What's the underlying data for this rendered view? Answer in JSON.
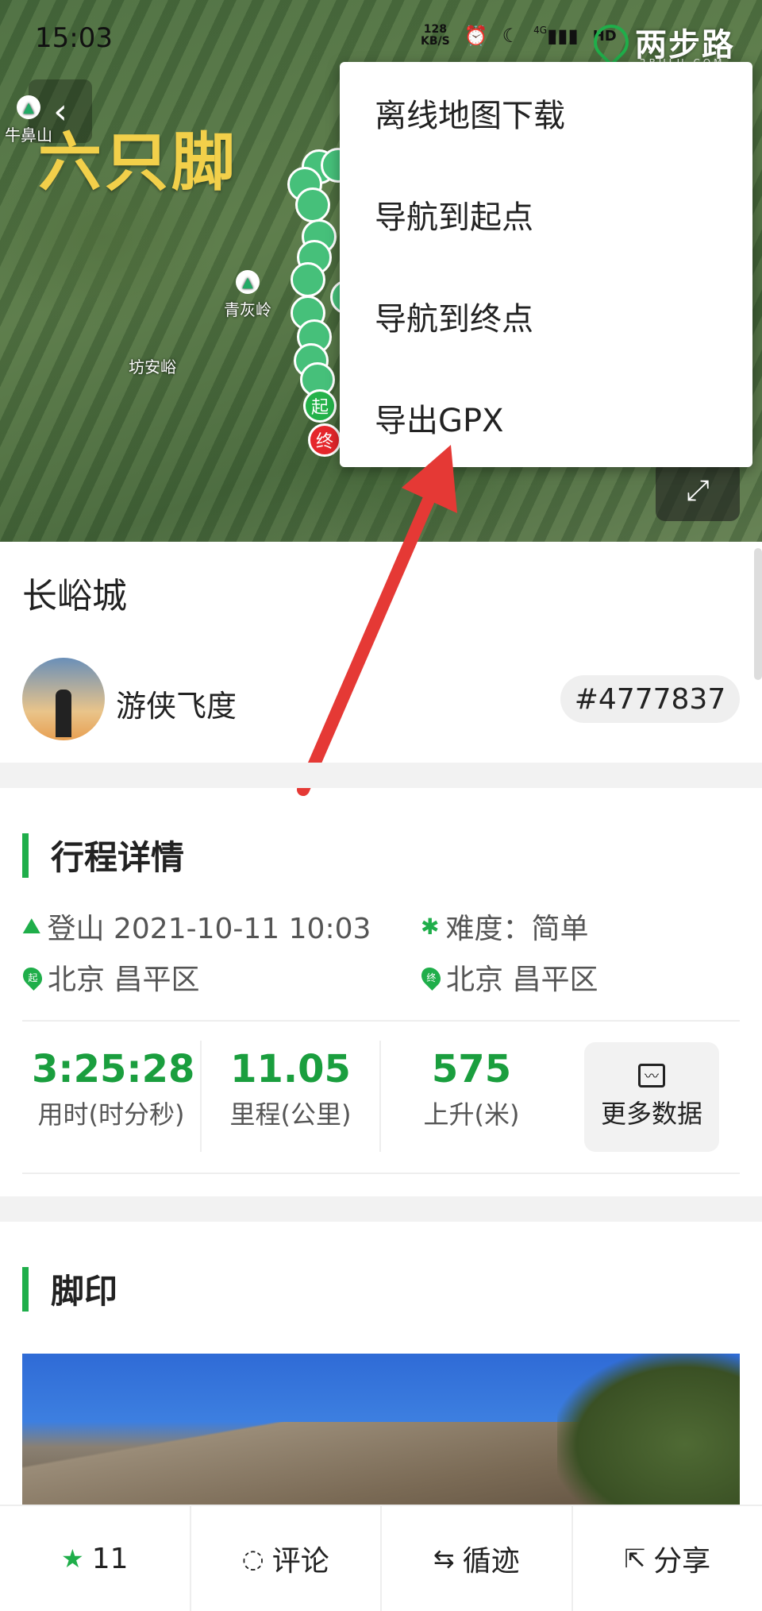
{
  "status": {
    "time": "15:03",
    "netspeed_top": "128",
    "netspeed_unit": "KB/S",
    "signal": "4G",
    "hd": "HD"
  },
  "brand": {
    "name": "两步路",
    "sub": "2BULU.COM"
  },
  "map": {
    "logo_text": "六只脚",
    "places": [
      {
        "name": "牛鼻山"
      },
      {
        "name": "青灰岭"
      },
      {
        "name": "坊安峪"
      }
    ],
    "start_label": "起",
    "end_label": "终"
  },
  "menu": {
    "items": [
      {
        "label": "离线地图下载"
      },
      {
        "label": "导航到起点"
      },
      {
        "label": "导航到终点"
      },
      {
        "label": "导出GPX"
      }
    ]
  },
  "trip": {
    "title": "长峪城",
    "user": "游侠飞度",
    "id": "#4777837"
  },
  "details": {
    "section_title": "行程详情",
    "activity": "登山 2021-10-11 10:03",
    "difficulty": "难度：简单",
    "start_place": "北京 昌平区",
    "end_place": "北京 昌平区",
    "start_pin": "起",
    "end_pin": "终"
  },
  "stats": [
    {
      "value": "3:25:28",
      "label": "用时(时分秒)"
    },
    {
      "value": "11.05",
      "label": "里程(公里)"
    },
    {
      "value": "575",
      "label": "上升(米)"
    }
  ],
  "more_data_label": "更多数据",
  "footprint": {
    "section_title": "脚印"
  },
  "bottom": {
    "likes": "11",
    "comment": "评论",
    "follow_track": "循迹",
    "share": "分享"
  },
  "colors": {
    "accent": "#1fae4a",
    "stat_value": "#1a9e3e",
    "end_marker": "#e5262b",
    "logo": "#f2d04a",
    "arrow": "#e53935"
  }
}
